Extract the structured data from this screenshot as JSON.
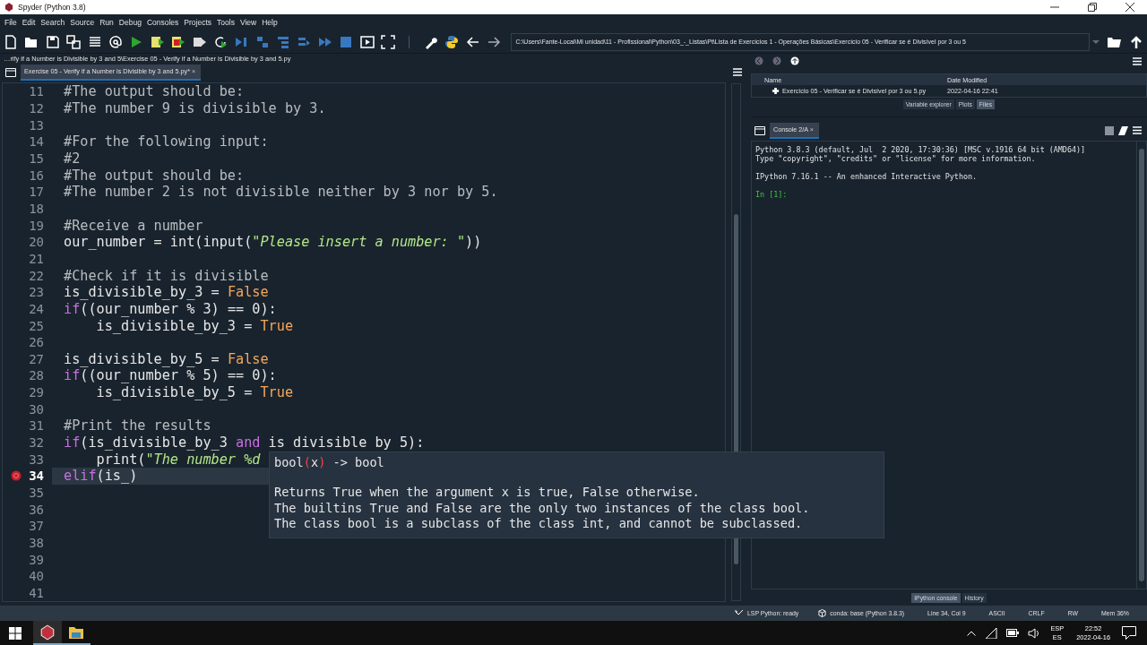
{
  "window": {
    "title": "Spyder (Python 3.8)"
  },
  "menu": [
    "File",
    "Edit",
    "Search",
    "Source",
    "Run",
    "Debug",
    "Consoles",
    "Projects",
    "Tools",
    "View",
    "Help"
  ],
  "path": "C:\\Users\\Fante-Local\\Mi unidad\\11 - Profissional\\Python\\03_-_Listas\\Pt\\Lista de Exercícios 1 - Operações Básicas\\Exercício 05 - Verificar se é Divisível por 3 ou 5",
  "editor": {
    "breadcrumb": "…rify if a Number is Divisible by 3 and 5\\Exercise 05 - Verify if a Number is Divisible by 3 and 5.py",
    "tabs": [
      {
        "label": "Exercise 05 - Verify if a Number is Divisible by 3 and 5.py*",
        "close": "×",
        "selected": true
      }
    ],
    "lines": [
      {
        "number": "11",
        "current": false,
        "breakpoint": false,
        "tokens": [
          {
            "kind": "comment",
            "text": "#The output should be:"
          }
        ]
      },
      {
        "number": "12",
        "current": false,
        "breakpoint": false,
        "tokens": [
          {
            "kind": "comment",
            "text": "#The number 9 is divisible by 3."
          }
        ]
      },
      {
        "number": "13",
        "current": false,
        "breakpoint": false
      },
      {
        "number": "14",
        "current": false,
        "breakpoint": false,
        "tokens": [
          {
            "kind": "comment",
            "text": "#For the following input:"
          }
        ]
      },
      {
        "number": "15",
        "current": false,
        "breakpoint": false,
        "tokens": [
          {
            "kind": "comment",
            "text": "#2"
          }
        ]
      },
      {
        "number": "16",
        "current": false,
        "breakpoint": false,
        "tokens": [
          {
            "kind": "comment",
            "text": "#The output should be:"
          }
        ]
      },
      {
        "number": "17",
        "current": false,
        "breakpoint": false,
        "tokens": [
          {
            "kind": "comment",
            "text": "#The number 2 is not divisible neither by 3 nor by 5."
          }
        ]
      },
      {
        "number": "18",
        "current": false,
        "breakpoint": false
      },
      {
        "number": "19",
        "current": false,
        "breakpoint": false,
        "tokens": [
          {
            "kind": "comment",
            "text": "#Receive a number"
          }
        ]
      },
      {
        "number": "20",
        "current": false,
        "breakpoint": false,
        "tokens": [
          {
            "kind": "text",
            "text": "our_number = int(input("
          },
          {
            "kind": "string",
            "text": "\"Please insert a number: \""
          },
          {
            "kind": "text",
            "text": "))"
          }
        ]
      },
      {
        "number": "21",
        "current": false,
        "breakpoint": false
      },
      {
        "number": "22",
        "current": false,
        "breakpoint": false,
        "tokens": [
          {
            "kind": "comment",
            "text": "#Check if it is divisible"
          }
        ]
      },
      {
        "number": "23",
        "current": false,
        "breakpoint": false,
        "tokens": [
          {
            "kind": "text",
            "text": "is_divisible_by_3 = "
          },
          {
            "kind": "constant",
            "text": "False"
          }
        ]
      },
      {
        "number": "24",
        "current": false,
        "breakpoint": false,
        "tokens": [
          {
            "kind": "keyword",
            "text": "if"
          },
          {
            "kind": "text",
            "text": "((our_number % 3) == 0):"
          }
        ]
      },
      {
        "number": "25",
        "current": false,
        "breakpoint": false,
        "tokens": [
          {
            "kind": "text",
            "text": "    is_divisible_by_3 = "
          },
          {
            "kind": "constant",
            "text": "True"
          }
        ]
      },
      {
        "number": "26",
        "current": false,
        "breakpoint": false
      },
      {
        "number": "27",
        "current": false,
        "breakpoint": false,
        "tokens": [
          {
            "kind": "text",
            "text": "is_divisible_by_5 = "
          },
          {
            "kind": "constant",
            "text": "False"
          }
        ]
      },
      {
        "number": "28",
        "current": false,
        "breakpoint": false,
        "tokens": [
          {
            "kind": "keyword",
            "text": "if"
          },
          {
            "kind": "text",
            "text": "((our_number % 5) == 0):"
          }
        ]
      },
      {
        "number": "29",
        "current": false,
        "breakpoint": false,
        "tokens": [
          {
            "kind": "text",
            "text": "    is_divisible_by_5 = "
          },
          {
            "kind": "constant",
            "text": "True"
          }
        ]
      },
      {
        "number": "30",
        "current": false,
        "breakpoint": false
      },
      {
        "number": "31",
        "current": false,
        "breakpoint": false,
        "tokens": [
          {
            "kind": "comment",
            "text": "#Print the results"
          }
        ]
      },
      {
        "number": "32",
        "current": false,
        "breakpoint": false,
        "tokens": [
          {
            "kind": "keyword",
            "text": "if"
          },
          {
            "kind": "text",
            "text": "(is_divisible_by_3 "
          },
          {
            "kind": "keyword",
            "text": "and"
          },
          {
            "kind": "text",
            "text": " is divisible by 5):"
          }
        ]
      },
      {
        "number": "33",
        "current": false,
        "breakpoint": false,
        "tokens": [
          {
            "kind": "text",
            "text": "    print("
          },
          {
            "kind": "string",
            "text": "\"The number %d"
          }
        ]
      },
      {
        "number": "34",
        "current": true,
        "breakpoint": true,
        "tokens": [
          {
            "kind": "keyword",
            "text": "elif"
          },
          {
            "kind": "text",
            "text": "(is_)"
          }
        ]
      },
      {
        "number": "35",
        "current": false,
        "breakpoint": false
      },
      {
        "number": "36",
        "current": false,
        "breakpoint": false
      },
      {
        "number": "37",
        "current": false,
        "breakpoint": false
      },
      {
        "number": "38",
        "current": false,
        "breakpoint": false
      },
      {
        "number": "39",
        "current": false,
        "breakpoint": false
      },
      {
        "number": "40",
        "current": false,
        "breakpoint": false
      },
      {
        "number": "41",
        "current": false,
        "breakpoint": false
      }
    ],
    "tooltip": {
      "signature": [
        {
          "kind": "text",
          "text": "bool"
        },
        {
          "kind": "paren",
          "text": "("
        },
        {
          "kind": "text",
          "text": "x"
        },
        {
          "kind": "paren",
          "text": ")"
        },
        {
          "kind": "text",
          "text": " -> bool"
        }
      ],
      "doc": [
        "Returns True when the argument x is true, False otherwise.",
        "The builtins True and False are the only two instances of the class bool.",
        "The class bool is a subclass of the class int, and cannot be subclassed."
      ]
    }
  },
  "files": {
    "columns": [
      "Name",
      "Date Modified"
    ],
    "rows": [
      {
        "name": "Exercício 05 - Verificar se é Divisível por 3 ou 5.py",
        "modified": "2022-04-16 22:41"
      }
    ],
    "tabs": [
      {
        "label": "Variable explorer",
        "selected": false
      },
      {
        "label": "Plots",
        "selected": false
      },
      {
        "label": "Files",
        "selected": true
      }
    ]
  },
  "console": {
    "tabs": [
      {
        "label": "Console 2/A",
        "close": "×",
        "selected": true
      }
    ],
    "lines": [
      "Python 3.8.3 (default, Jul  2 2020, 17:30:36) [MSC v.1916 64 bit (AMD64)]",
      "Type \"copyright\", \"credits\" or \"license\" for more information."
    ],
    "banner": "IPython 7.16.1 -- An enhanced Interactive Python.",
    "prompt": "In [1]:",
    "bottom_tabs": [
      {
        "label": "IPython console",
        "selected": true
      },
      {
        "label": "History",
        "selected": false
      }
    ]
  },
  "status_bar": {
    "lsp": "LSP Python: ready",
    "conda": "conda: base (Python 3.8.3)",
    "items": [
      "Line 34, Col 9",
      "ASCII",
      "CRLF",
      "RW",
      "Mem 36%"
    ]
  },
  "taskbar": {
    "language": "ESP",
    "layout": "ES",
    "time": "22:52",
    "date": "2022-04-16"
  }
}
